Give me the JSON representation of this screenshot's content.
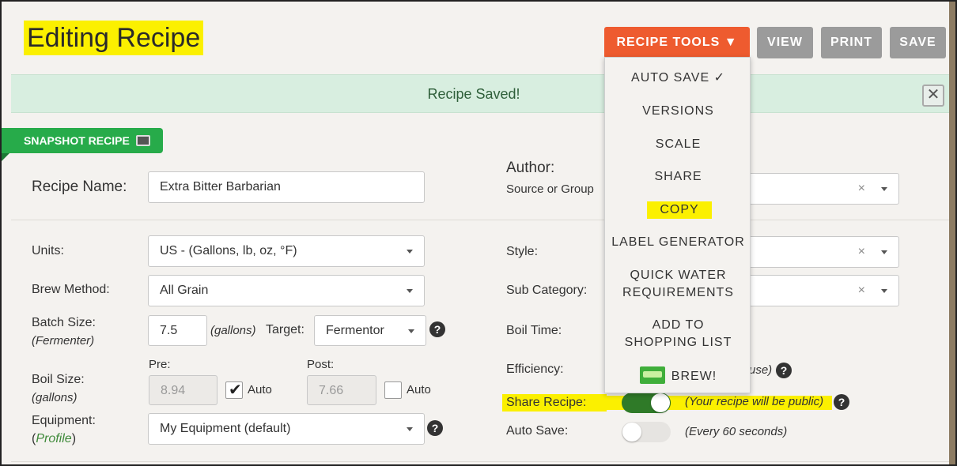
{
  "header": {
    "title": "Editing Recipe"
  },
  "toolbar": {
    "recipe_tools": "RECIPE TOOLS ▼",
    "view": "VIEW",
    "print": "PRINT",
    "save": "SAVE"
  },
  "notice": {
    "text": "Recipe Saved!",
    "close": "✕"
  },
  "snapshot": {
    "label": "SNAPSHOT RECIPE"
  },
  "form": {
    "recipe_name_label": "Recipe Name:",
    "recipe_name_value": "Extra Bitter Barbarian",
    "author_label": "Author:",
    "author_sub": "Source or Group",
    "units_label": "Units:",
    "units_value": "US - (Gallons, lb, oz, °F)",
    "style_label": "Style:",
    "brew_method_label": "Brew Method:",
    "brew_method_value": "All Grain",
    "sub_category_label": "Sub Category:",
    "batch_size_label": "Batch Size:",
    "batch_size_sub": "(Fermenter)",
    "batch_size_value": "7.5",
    "batch_size_unit": "(gallons)",
    "target_label": "Target:",
    "target_value": "Fermentor",
    "boil_time_label": "Boil Time:",
    "boil_size_label": "Boil Size:",
    "boil_size_sub": "(gallons)",
    "pre_label": "Pre:",
    "pre_value": "8.94",
    "pre_auto": "Auto",
    "post_label": "Post:",
    "post_value": "7.66",
    "post_auto": "Auto",
    "efficiency_label": "Efficiency:",
    "efficiency_tail": "use)",
    "share_label": "Share Recipe:",
    "share_note": "(Your recipe will be public)",
    "equipment_label": "Equipment:",
    "equipment_profile_open": "(",
    "equipment_profile": "Profile",
    "equipment_profile_close": ")",
    "equipment_value": "My Equipment (default)",
    "autosave_label": "Auto Save:",
    "autosave_note": "(Every 60 seconds)",
    "clear": "×",
    "help": "?"
  },
  "menu": {
    "items": [
      "AUTO SAVE ✓",
      "VERSIONS",
      "SCALE",
      "SHARE",
      "COPY",
      "LABEL GENERATOR",
      "QUICK WATER REQUIREMENTS",
      "ADD TO SHOPPING LIST",
      "BREW!"
    ],
    "quick_water_line1": "QUICK WATER",
    "quick_water_line2": "REQUIREMENTS",
    "add_to_line1": "ADD TO",
    "add_to_line2": "SHOPPING LIST"
  },
  "colors": {
    "accent": "#ee5b2f",
    "success_bg": "#d8eee0",
    "snapshot_green": "#27ab4a",
    "highlight": "#fbf000",
    "toggle_on": "#2f7a28"
  }
}
